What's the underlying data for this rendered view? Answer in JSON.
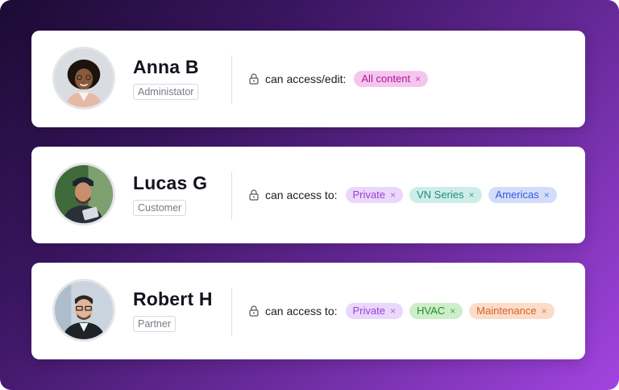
{
  "users": [
    {
      "name": "Anna B",
      "role": "Administator",
      "access_label": "can access/edit:",
      "tags": [
        {
          "label": "All content",
          "color": "#b0179a",
          "bg": "#f4c6ee"
        }
      ]
    },
    {
      "name": "Lucas G",
      "role": "Customer",
      "access_label": "can access to:",
      "tags": [
        {
          "label": "Private",
          "color": "#9b3fd6",
          "bg": "#ead7fb"
        },
        {
          "label": "VN Series",
          "color": "#1f8a7b",
          "bg": "#cdeee8"
        },
        {
          "label": "Americas",
          "color": "#3559d8",
          "bg": "#d3ddfb"
        }
      ]
    },
    {
      "name": "Robert H",
      "role": "Partner",
      "access_label": "can access to:",
      "tags": [
        {
          "label": "Private",
          "color": "#9b3fd6",
          "bg": "#ead7fb"
        },
        {
          "label": "HVAC",
          "color": "#2b8a2e",
          "bg": "#cdeec9"
        },
        {
          "label": "Maintenance",
          "color": "#d8612a",
          "bg": "#fbdcc9"
        }
      ]
    }
  ],
  "remove_symbol": "×",
  "icons": {
    "lock": "lock-icon"
  }
}
